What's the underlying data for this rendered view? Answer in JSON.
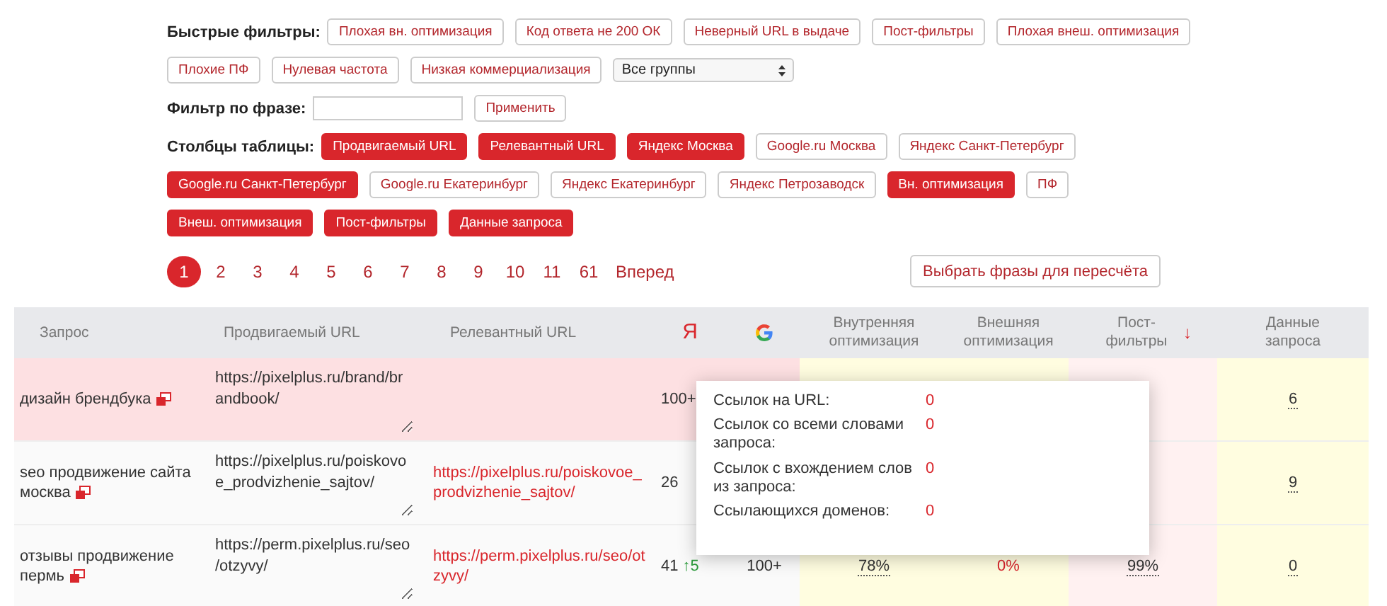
{
  "quick_filters": {
    "label": "Быстрые фильтры:",
    "buttons": [
      "Плохая вн. оптимизация",
      "Код ответа не 200 ОК",
      "Неверный URL в выдаче",
      "Пост-фильтры",
      "Плохая внеш. оптимизация",
      "Плохие ПФ",
      "Нулевая частота",
      "Низкая коммерциализация"
    ],
    "group_select": {
      "value": "Все группы"
    }
  },
  "phrase_filter": {
    "label": "Фильтр по фразе:",
    "apply_button": "Применить"
  },
  "column_toggles": {
    "label": "Столбцы таблицы:",
    "items": [
      {
        "label": "Продвигаемый URL",
        "selected": true
      },
      {
        "label": "Релевантный URL",
        "selected": true
      },
      {
        "label": "Яндекс Москва",
        "selected": true
      },
      {
        "label": "Google.ru Москва",
        "selected": false
      },
      {
        "label": "Яндекс Санкт-Петербург",
        "selected": false
      },
      {
        "label": "Google.ru Санкт-Петербург",
        "selected": true
      },
      {
        "label": "Google.ru Екатеринбург",
        "selected": false
      },
      {
        "label": "Яндекс Екатеринбург",
        "selected": false
      },
      {
        "label": "Яндекс Петрозаводск",
        "selected": false
      },
      {
        "label": "Вн. оптимизация",
        "selected": true
      },
      {
        "label": "ПФ",
        "selected": false
      },
      {
        "label": "Внеш. оптимизация",
        "selected": true
      },
      {
        "label": "Пост-фильтры",
        "selected": true
      },
      {
        "label": "Данные запроса",
        "selected": true
      }
    ]
  },
  "pagination": {
    "pages": [
      {
        "label": "1",
        "selected": true
      },
      {
        "label": "2",
        "selected": false
      },
      {
        "label": "3",
        "selected": false
      },
      {
        "label": "4",
        "selected": false
      },
      {
        "label": "5",
        "selected": false
      },
      {
        "label": "6",
        "selected": false
      },
      {
        "label": "7",
        "selected": false
      },
      {
        "label": "8",
        "selected": false
      },
      {
        "label": "9",
        "selected": false
      },
      {
        "label": "10",
        "selected": false
      },
      {
        "label": "11",
        "selected": false
      },
      {
        "label": "61",
        "selected": false
      }
    ],
    "next": "Вперед"
  },
  "recalc_button": "Выбрать фразы для пересчёта",
  "table": {
    "columns": [
      {
        "kind": "text",
        "label": "Запрос"
      },
      {
        "kind": "text",
        "label": "Продвигаемый URL"
      },
      {
        "kind": "text",
        "label": "Релевантный URL"
      },
      {
        "kind": "yandex",
        "label": "Я"
      },
      {
        "kind": "google"
      },
      {
        "kind": "text",
        "label": "Внутренняя оптимизация"
      },
      {
        "kind": "text",
        "label": "Внешняя оптимизация"
      },
      {
        "kind": "text",
        "label": "Пост-фильтры",
        "sort_arrow": "↓"
      },
      {
        "kind": "text",
        "label": "Данные запроса"
      }
    ],
    "rows": [
      {
        "query": "дизайн брендбука",
        "highlighted": true,
        "promoted_url": "https://pixelplus.ru/brand/brandbook/",
        "yandex": "100+",
        "data": "6"
      },
      {
        "query": "seo продвижение сайта москва",
        "highlighted": false,
        "promoted_url": "https://pixelplus.ru/poiskovoe_prodvizhenie_sajtov/",
        "relevant_url": "https://pixelplus.ru/poiskovoe_prodvizhenie_sajtov/",
        "yandex": "26",
        "data": "9"
      },
      {
        "query": "отзывы продвижение пермь",
        "highlighted": false,
        "promoted_url": "https://perm.pixelplus.ru/seo/otzyvy/",
        "relevant_url": "https://perm.pixelplus.ru/seo/otzyvy/",
        "yandex": "41",
        "yandex_change": "↑5",
        "google": "100+",
        "internal": "78%",
        "external": "0%",
        "external_alert": true,
        "post_filters": "99%",
        "data": "0"
      }
    ]
  },
  "popup": {
    "items": [
      {
        "label": "Ссылок на URL:",
        "value": "0"
      },
      {
        "label": "Ссылок со всеми словами запроса:",
        "value": "0"
      },
      {
        "label": "Ссылок с вхождением слов из запроса:",
        "value": "0"
      },
      {
        "label": "Ссылающихся доменов:",
        "value": "0"
      }
    ]
  }
}
